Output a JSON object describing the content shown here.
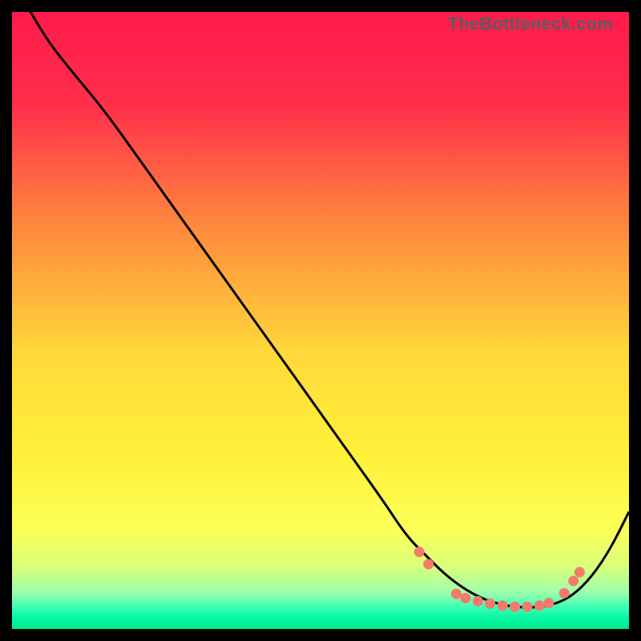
{
  "watermark": "TheBottleneck.com",
  "chart_data": {
    "type": "line",
    "title": "",
    "xlabel": "",
    "ylabel": "",
    "xlim": [
      0,
      100
    ],
    "ylim": [
      0,
      100
    ],
    "axes_visible": false,
    "grid": false,
    "gradient_stops": [
      {
        "offset": 0.0,
        "color": "#ff1a4d"
      },
      {
        "offset": 0.15,
        "color": "#ff2f4a"
      },
      {
        "offset": 0.35,
        "color": "#ff8a3d"
      },
      {
        "offset": 0.55,
        "color": "#ffd83a"
      },
      {
        "offset": 0.72,
        "color": "#fff13a"
      },
      {
        "offset": 0.84,
        "color": "#fbff58"
      },
      {
        "offset": 0.9,
        "color": "#d8ff7a"
      },
      {
        "offset": 0.94,
        "color": "#9dffac"
      },
      {
        "offset": 0.965,
        "color": "#3affb5"
      },
      {
        "offset": 0.985,
        "color": "#00f59e"
      },
      {
        "offset": 1.0,
        "color": "#00e890"
      }
    ],
    "series": [
      {
        "name": "bottleneck-curve",
        "x": [
          0,
          3,
          6,
          10,
          15,
          20,
          25,
          30,
          35,
          40,
          45,
          50,
          55,
          60,
          64,
          67,
          70,
          73,
          76,
          79,
          82,
          85,
          88,
          91,
          94,
          97,
          100
        ],
        "y": [
          105,
          100,
          95,
          90,
          84,
          77,
          70,
          63,
          56,
          49,
          42,
          35,
          28,
          21,
          15,
          12,
          9,
          6.7,
          5.0,
          4.0,
          3.5,
          3.5,
          4.0,
          5.5,
          8.5,
          13,
          19
        ],
        "color": "#000000",
        "width": 3
      }
    ],
    "markers": {
      "name": "sweet-spot-dots",
      "color": "#f47a6b",
      "radius": 6.5,
      "points": [
        {
          "x": 66.0,
          "y": 12.5
        },
        {
          "x": 67.5,
          "y": 10.5
        },
        {
          "x": 72.0,
          "y": 5.7
        },
        {
          "x": 73.5,
          "y": 5.0
        },
        {
          "x": 75.5,
          "y": 4.5
        },
        {
          "x": 77.5,
          "y": 4.1
        },
        {
          "x": 79.5,
          "y": 3.8
        },
        {
          "x": 81.5,
          "y": 3.6
        },
        {
          "x": 83.5,
          "y": 3.6
        },
        {
          "x": 85.5,
          "y": 3.8
        },
        {
          "x": 87.0,
          "y": 4.2
        },
        {
          "x": 89.5,
          "y": 5.8
        },
        {
          "x": 91.0,
          "y": 7.8
        },
        {
          "x": 92.0,
          "y": 9.2
        }
      ]
    }
  }
}
